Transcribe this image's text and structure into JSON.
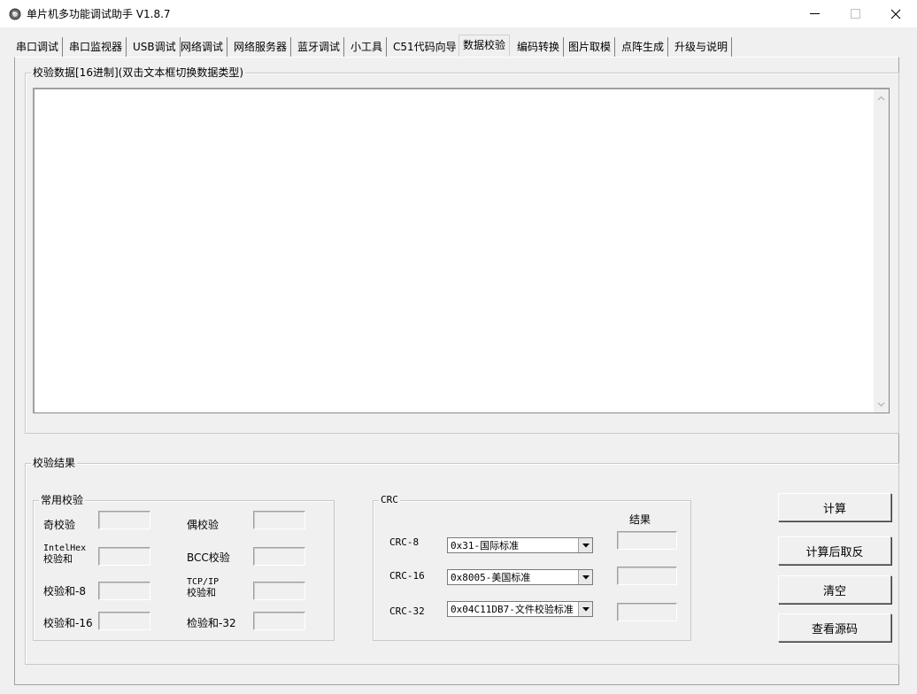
{
  "window": {
    "title": "单片机多功能调试助手 V1.8.7",
    "min_glyph": "—",
    "max_glyph": "☐",
    "close_glyph": "✕"
  },
  "tabs": [
    {
      "label": "串口调试"
    },
    {
      "label": "串口监视器"
    },
    {
      "label": "USB调试"
    },
    {
      "label": "网络调试"
    },
    {
      "label": "网络服务器"
    },
    {
      "label": "蓝牙调试"
    },
    {
      "label": "小工具"
    },
    {
      "label": "C51代码向导"
    },
    {
      "label": "数据校验",
      "selected": true
    },
    {
      "label": "编码转换"
    },
    {
      "label": "图片取模"
    },
    {
      "label": "点阵生成"
    },
    {
      "label": "升级与说明"
    }
  ],
  "input_group": {
    "title": "校验数据[16进制](双击文本框切换数据类型)",
    "value": ""
  },
  "result_group": {
    "title": "校验结果",
    "common": {
      "title": "常用校验",
      "odd_label": "奇校验",
      "even_label": "偶校验",
      "intelhex_line1": "IntelHex",
      "intelhex_line2": "校验和",
      "bcc_label": "BCC校验",
      "sum8_label": "校验和-8",
      "tcpip_line1": "TCP/IP",
      "tcpip_line2": "校验和",
      "sum16_label": "校验和-16",
      "sum32_label": "检验和-32"
    },
    "crc": {
      "title": "CRC",
      "result_header": "结果",
      "crc8_label": "CRC-8",
      "crc8_value": "0x31-国际标准",
      "crc16_label": "CRC-16",
      "crc16_value": "0x8005-美国标准",
      "crc32_label": "CRC-32",
      "crc32_value": "0x04C11DB7-文件校验标准"
    }
  },
  "buttons": {
    "calculate": "计算",
    "calculate_invert": "计算后取反",
    "clear": "清空",
    "view_source": "查看源码"
  },
  "icons": {
    "app": "app-logo-icon",
    "scroll_up": "scroll-up-arrow-icon",
    "scroll_down": "scroll-down-arrow-icon",
    "dropdown": "dropdown-arrow-icon"
  }
}
